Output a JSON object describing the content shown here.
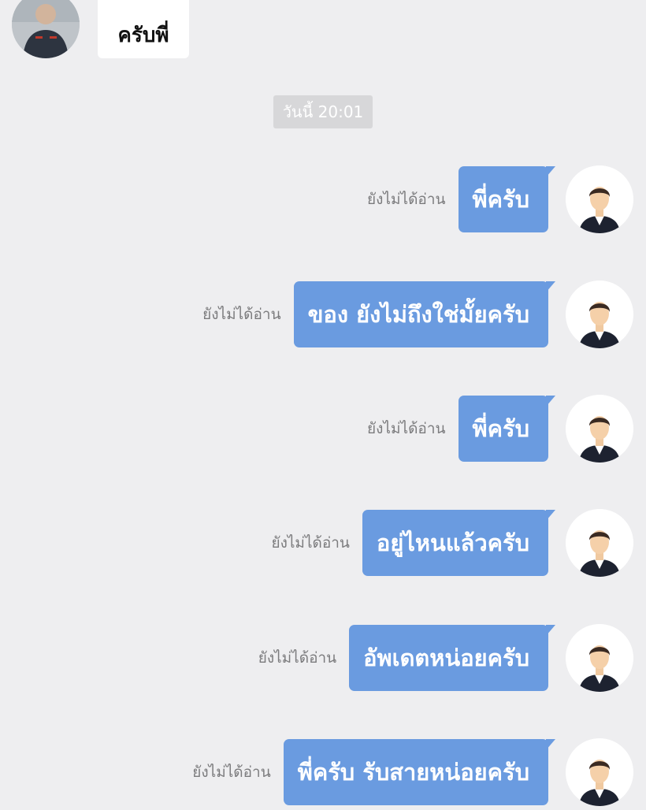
{
  "incoming": {
    "text": "ครับพี่",
    "avatar_icon": "contact-profile-photo"
  },
  "timestamp": "วันนี้ 20:01",
  "colors": {
    "background": "#eeeef0",
    "outgoing_bubble": "#6a9be0",
    "incoming_bubble": "#ffffff",
    "read_status": "#7b7b7d"
  },
  "messages": [
    {
      "text": "พี่ครับ",
      "status": "ยังไม่ได้อ่าน",
      "avatar_icon": "default-user-avatar-icon"
    },
    {
      "text": "ของ ยังไม่ถึงใช่มั้ยครับ",
      "status": "ยังไม่ได้อ่าน",
      "avatar_icon": "default-user-avatar-icon"
    },
    {
      "text": "พี่ครับ",
      "status": "ยังไม่ได้อ่าน",
      "avatar_icon": "default-user-avatar-icon"
    },
    {
      "text": "อยู่ไหนแล้วครับ",
      "status": "ยังไม่ได้อ่าน",
      "avatar_icon": "default-user-avatar-icon"
    },
    {
      "text": "อัพเดตหน่อยครับ",
      "status": "ยังไม่ได้อ่าน",
      "avatar_icon": "default-user-avatar-icon"
    },
    {
      "text": "พี่ครับ รับสายหน่อยครับ",
      "status": "ยังไม่ได้อ่าน",
      "avatar_icon": "default-user-avatar-icon"
    }
  ]
}
